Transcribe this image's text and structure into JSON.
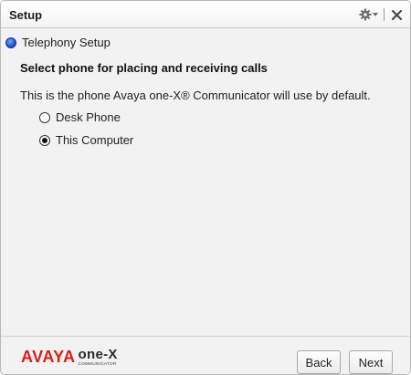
{
  "window": {
    "title": "Setup"
  },
  "titlebar": {
    "settings_icon": "gear-icon",
    "dropdown_icon": "chevron-down-icon",
    "close_icon": "close-icon"
  },
  "step": {
    "label": "Telephony Setup",
    "status_color": "#1446c6"
  },
  "main": {
    "heading": "Select phone for placing and receiving calls",
    "description": "This is the phone Avaya one-X® Communicator will use by default.",
    "options": [
      {
        "label": "Desk Phone",
        "selected": false
      },
      {
        "label": "This Computer",
        "selected": true
      }
    ]
  },
  "footer": {
    "logo": {
      "brand": "AVAYA",
      "product": "one-X",
      "sub": "COMMUNICATOR"
    },
    "back_label": "Back",
    "next_label": "Next"
  },
  "colors": {
    "brand_red": "#d91e18",
    "accent_blue": "#1446c6"
  }
}
